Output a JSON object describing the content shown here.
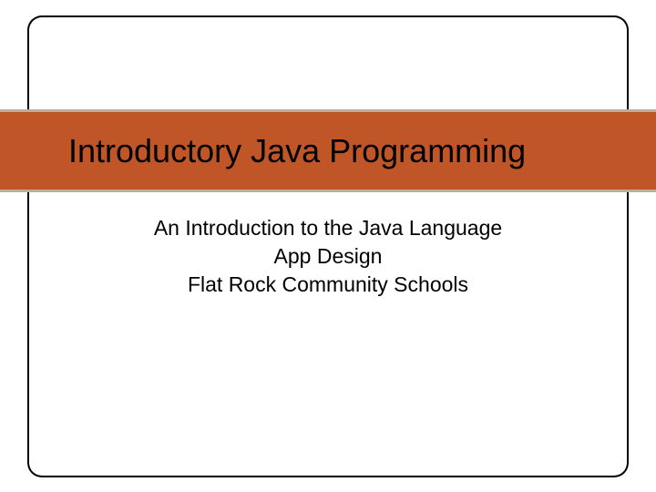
{
  "slide": {
    "title": "Introductory Java Programming",
    "subtitle_line1": "An Introduction to the Java Language",
    "subtitle_line2": "App Design",
    "subtitle_line3": "Flat Rock Community Schools"
  },
  "colors": {
    "band_bg": "#c05528",
    "band_border": "#b8b09a",
    "frame_border": "#000000"
  }
}
